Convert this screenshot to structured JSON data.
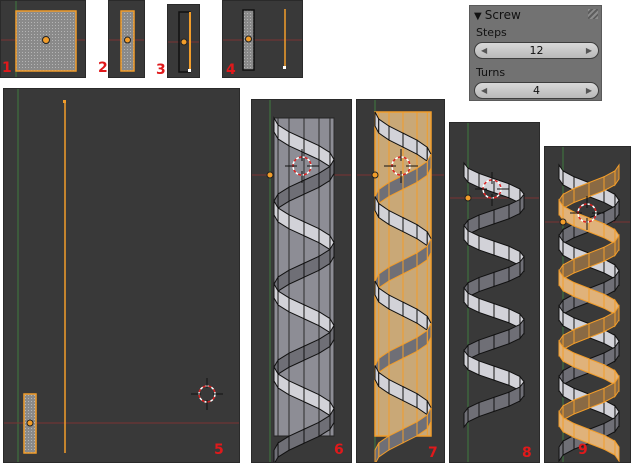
{
  "labels": [
    "1",
    "2",
    "3",
    "4",
    "5",
    "6",
    "7",
    "8",
    "9"
  ],
  "panel": {
    "title": "Screw",
    "steps_label": "Steps",
    "steps_value": "12",
    "turns_label": "Turns",
    "turns_value": "4"
  },
  "colors": {
    "viewport_bg": "#393939",
    "selection": "#f29d2a",
    "axis_green": "#3e8a3e",
    "axis_red": "#8a2f2f",
    "label_red": "#e0191b"
  }
}
